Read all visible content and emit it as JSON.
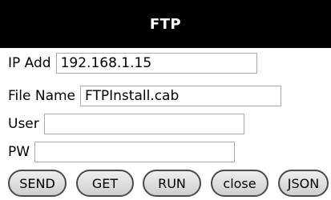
{
  "header": {
    "title": "FTP"
  },
  "form": {
    "ip_label": "IP Add",
    "ip_value": "192.168.1.15",
    "file_label": "File Name",
    "file_value": "FTPInstall.cab",
    "user_label": "User",
    "user_value": "",
    "pw_label": "PW",
    "pw_value": ""
  },
  "buttons": {
    "send": "SEND",
    "get": "GET",
    "run": "RUN",
    "close": "close",
    "json": "JSON"
  },
  "colors": {
    "title_bar_bg": "#000000",
    "title_text": "#ffffff"
  }
}
